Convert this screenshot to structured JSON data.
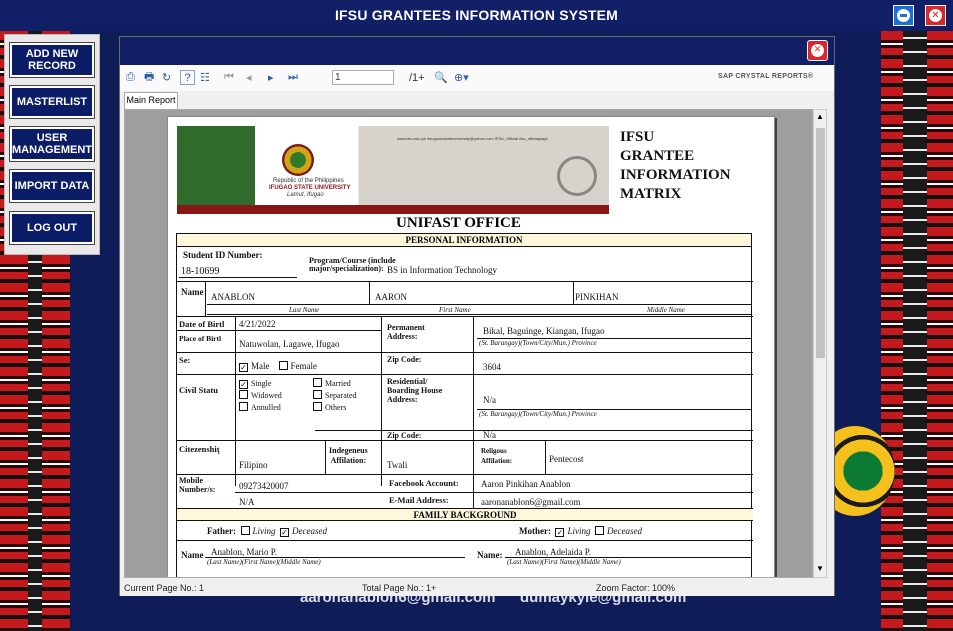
{
  "app": {
    "title": "IFSU GRANTEES INFORMATION SYSTEM"
  },
  "background": {
    "email1": "aaronanablon6@gmail.com",
    "email2": "dumaykyle@gmail.com"
  },
  "sidebar": {
    "buttons": [
      {
        "label": "ADD NEW\nRECORD"
      },
      {
        "label": "MASTERLIST"
      },
      {
        "label": "USER\nMANAGEMENT"
      },
      {
        "label": "IMPORT DATA"
      },
      {
        "label": "LOG OUT"
      }
    ]
  },
  "viewer": {
    "page_input": "1",
    "page_count": "/1+",
    "brand": "SAP CRYSTAL REPORTS®",
    "tab": "Main Report",
    "status": {
      "current": "Current Page No.: 1",
      "total": "Total Page No.: 1+",
      "zoom": "Zoom Factor: 100%"
    }
  },
  "report": {
    "banner": {
      "republic": "Republic of the Philippines",
      "univ": "IFUGAO STATE UNIVERSITY",
      "town": "Lamut, Ifugao",
      "social": "www.ifsu.edu.ph   ifsugaoesstateuniversity@yahoo.com   IFSU_Official   ifsu_officialpage"
    },
    "title": [
      "IFSU",
      "GRANTEE",
      "INFORMATION",
      "MATRIX"
    ],
    "office": "UNIFAST OFFICE",
    "sections": {
      "personal": "PERSONAL INFORMATION",
      "family": "FAMILY BACKGROUND"
    },
    "labels": {
      "student_id": "Student ID Number:",
      "program": "Program/Course (include",
      "program2": "major/specialization):",
      "name": "Name",
      "last": "Last Name",
      "first": "First Name",
      "middle": "Middle Name",
      "dob": "Date of Birtl",
      "pob": "Place of Birtl",
      "sex": "Se:",
      "civil": "Civil Statu",
      "perm": "Permanent",
      "perm2": "Address:",
      "addr_cap": "(St. Barangay)(Town/City/Mun.) Province",
      "zip": "Zip Code:",
      "zip2": "Zip Code:",
      "res": "Residential/",
      "res2": "Boarding House",
      "res3": "Address:",
      "citizen": "Citezenshiţ",
      "indig": "Indegeneus",
      "indig2": "Affilation:",
      "relig": "Religous",
      "relig2": "Affilation:",
      "mobile": "Mobile",
      "mobile2": "Number/s:",
      "fb": "Facebook Account:",
      "email": "E-Mail Address:",
      "father": "Father:",
      "mother": "Mother:",
      "living": "Living",
      "deceased": "Deceased",
      "fname": "Name",
      "mname": "Name:",
      "fam_cap": "(Last Name)(First Name)(Middle Name)",
      "male": "Male",
      "female": "Female",
      "single": "Single",
      "married": "Married",
      "widowed": "Widowed",
      "separated": "Separated",
      "annulled": "Annulled",
      "others": "Others"
    },
    "values": {
      "student_id": "18-10699",
      "program": "BS in Information Technology",
      "last": "ANABLON",
      "first": "AARON",
      "middle": "PINKIHAN",
      "dob": "4/21/2022",
      "pob": "Natuwolan, Lagawe, Ifugao",
      "perm": "Bikal, Baguinge, Kiangan, Ifugao",
      "zip": "3604",
      "res": "N/a",
      "res_zip": "N/a",
      "citizen": "Filipino",
      "indig": "Twali",
      "relig": "Pentecost",
      "mobile1": "09273420007",
      "mobile2": "N/A",
      "fb": "Aaron Pinkihan Anablon",
      "email": "aaronanablon6@gmail.com",
      "father": "Anablon, Mario P.",
      "mother": "Anablon, Adelaida P."
    }
  }
}
